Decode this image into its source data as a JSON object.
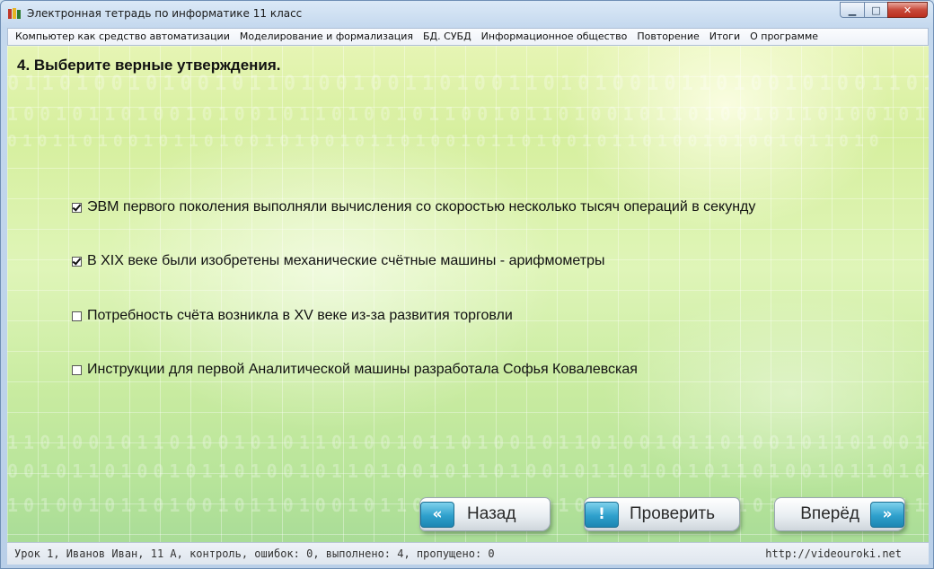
{
  "window": {
    "title": "Электронная тетрадь по информатике 11 класс",
    "icon": "books-icon"
  },
  "menu": [
    "Компьютер как средство автоматизации",
    "Моделирование и формализация",
    "БД. СУБД",
    "Информационное общество",
    "Повторение",
    "Итоги",
    "О программе"
  ],
  "question": {
    "title": "4. Выберите верные утверждения.",
    "options": [
      {
        "label": "ЭВМ первого поколения выполняли вычисления со скоростью несколько тысяч операций в секунду",
        "checked": true
      },
      {
        "label": "В XIX веке были изобретены механические счётные машины - арифмометры",
        "checked": true
      },
      {
        "label": "Потребность счёта возникла в XV веке из-за развития торговли",
        "checked": false
      },
      {
        "label": "Инструкции для первой Аналитической машины разработала Софья Ковалевская",
        "checked": false
      }
    ]
  },
  "buttons": {
    "back": {
      "label": "Назад",
      "icon": "double-chevron-left-icon",
      "glyph": "«"
    },
    "check": {
      "label": "Проверить",
      "icon": "exclamation-icon",
      "glyph": "!"
    },
    "forward": {
      "label": "Вперёд",
      "icon": "double-chevron-right-icon",
      "glyph": "»"
    }
  },
  "status": {
    "left": "Урок 1, Иванов Иван, 11 А, контроль, ошибок: 0, выполнено: 4, пропущено: 0",
    "right": "http://videouroki.net"
  },
  "colors": {
    "accent": "#2ea0cc",
    "background_top": "#e6f5b4",
    "background_bottom": "#a9dc97"
  }
}
